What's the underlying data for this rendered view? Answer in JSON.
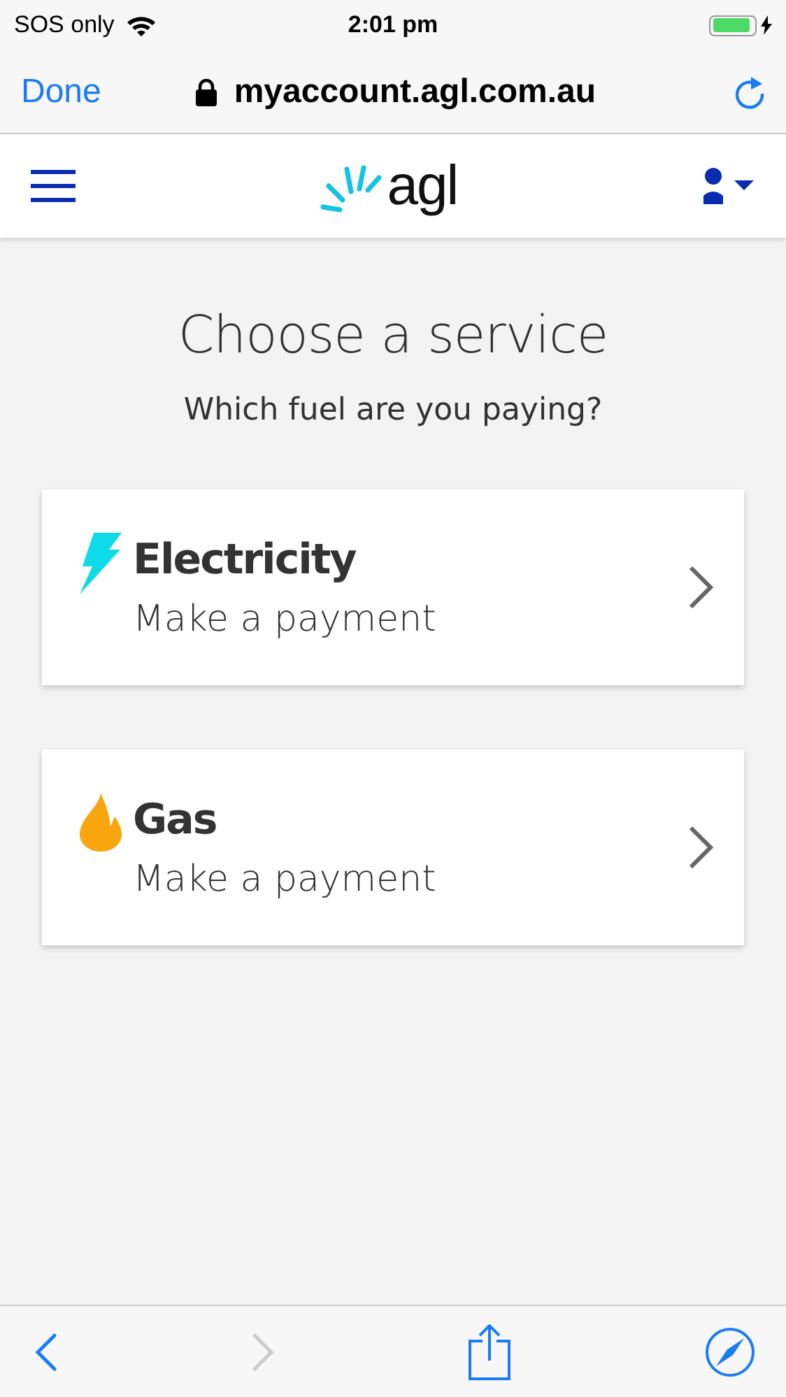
{
  "status_bar": {
    "carrier": "SOS only",
    "time": "2:01 pm",
    "charging": true
  },
  "browser_bar": {
    "done": "Done",
    "url": "myaccount.agl.com.au"
  },
  "site_header": {
    "logo": "agl"
  },
  "page": {
    "title": "Choose a service",
    "subtitle": "Which fuel are you paying?"
  },
  "services": [
    {
      "kind": "electricity",
      "name": "Electricity",
      "action": "Make a payment"
    },
    {
      "kind": "gas",
      "name": "Gas",
      "action": "Make a payment"
    }
  ],
  "toolbar": {
    "back_disabled": false,
    "forward_disabled": true
  }
}
